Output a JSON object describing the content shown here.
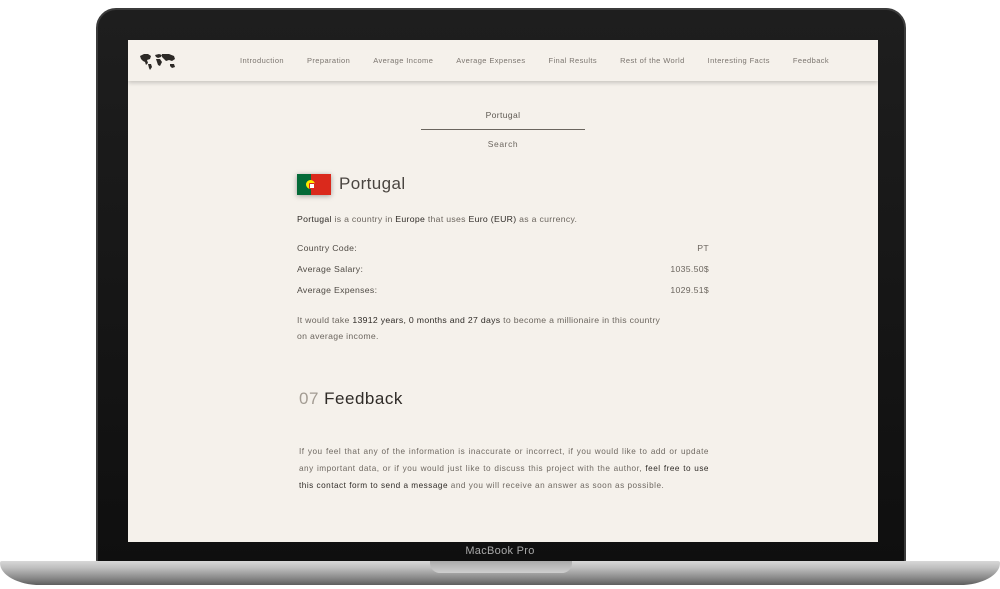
{
  "device": {
    "label": "MacBook Pro"
  },
  "nav": {
    "items": [
      "Introduction",
      "Preparation",
      "Average Income",
      "Average Expenses",
      "Final Results",
      "Rest of the World",
      "Interesting Facts",
      "Feedback"
    ]
  },
  "search": {
    "value": "Portugal",
    "button_label": "Search"
  },
  "country": {
    "name": "Portugal",
    "description": {
      "name": "Portugal",
      "text1": " is a country in ",
      "continent": "Europe",
      "text2": " that uses ",
      "currency": "Euro (EUR)",
      "text3": " as a currency."
    },
    "rows": [
      {
        "label": "Country Code:",
        "value": "PT"
      },
      {
        "label": "Average Salary:",
        "value": "1035.50$"
      },
      {
        "label": "Average Expenses:",
        "value": "1029.51$"
      }
    ],
    "millionaire": {
      "prefix": "It would take ",
      "duration": "13912 years, 0 months and 27 days",
      "suffix_line1": " to become a millionaire in this country",
      "suffix_line2": "on average income."
    }
  },
  "feedback_section": {
    "number": "07",
    "title": "Feedback",
    "text_before": "If you feel that any of the information is inaccurate or incorrect, if you would like to add or update any important data, or if you would just like to discuss this project with the author, ",
    "link": "feel free to use this contact form to send a message",
    "text_after": " and you will receive an answer as soon as possible."
  },
  "colors": {
    "background": "#f5f1eb",
    "text": "#6b655e",
    "accent_dark": "#2f2b27",
    "flag_green": "#046a38",
    "flag_red": "#da291c"
  }
}
